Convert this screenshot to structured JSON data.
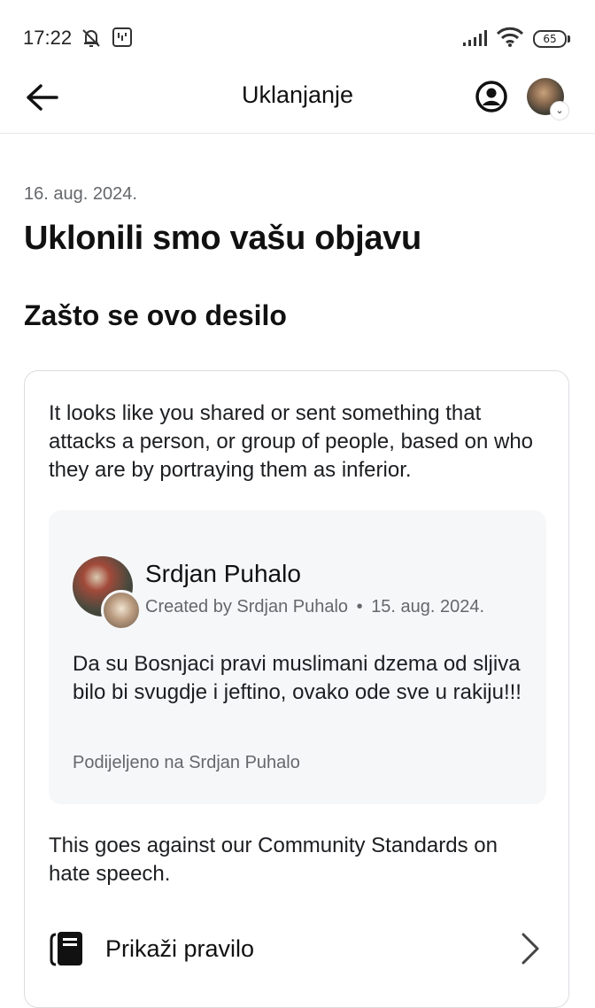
{
  "status_bar": {
    "time": "17:22",
    "battery": "65",
    "icons": [
      "muted-bell-icon",
      "notification-app-icon",
      "signal-icon",
      "wifi-icon",
      "battery-icon"
    ]
  },
  "header": {
    "title": "Uklanjanje",
    "icons": [
      "back-arrow-icon",
      "profile-circle-icon",
      "avatar"
    ]
  },
  "content": {
    "date": "16. aug. 2024.",
    "title": "Uklonili smo vašu objavu",
    "section_title": "Zašto se ovo desilo",
    "reason": "It looks like you shared or sent something that attacks a person, or group of people, based on who they are by portraying them as inferior.",
    "post": {
      "author": "Srdjan Puhalo",
      "created_by": "Created by Srdjan Puhalo",
      "separator": "•",
      "date": "15. aug. 2024.",
      "text": "Da su Bosnjaci pravi muslimani dzema od sljiva bilo bi svugdje i jeftino, ovako ode sve u rakiju!!!",
      "shared_on": "Podijeljeno na Srdjan Puhalo"
    },
    "standards_text": "This goes against our Community Standards on hate speech.",
    "rule_link": {
      "label": "Prikaži pravilo",
      "icon": "rulebook-icon"
    }
  },
  "colors": {
    "text_primary": "#1c1e21",
    "text_secondary": "#65676b",
    "card_border": "#dadde1",
    "post_background": "#f6f7f9"
  }
}
